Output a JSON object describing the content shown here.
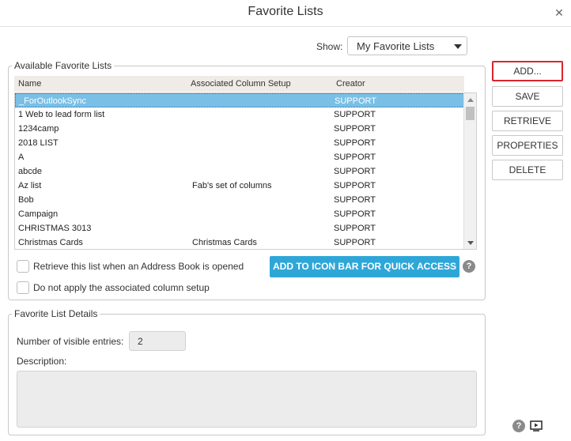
{
  "dialog": {
    "title": "Favorite Lists"
  },
  "show": {
    "label": "Show:",
    "selected": "My Favorite Lists"
  },
  "available": {
    "legend": "Available Favorite Lists",
    "columns": [
      "Name",
      "Associated Column Setup",
      "Creator"
    ],
    "rows": [
      {
        "name": "_ForOutlookSync",
        "setup": "",
        "creator": "SUPPORT",
        "selected": true
      },
      {
        "name": "1 Web to lead form list",
        "setup": "",
        "creator": "SUPPORT"
      },
      {
        "name": "1234camp",
        "setup": "",
        "creator": "SUPPORT"
      },
      {
        "name": "2018 LIST",
        "setup": "",
        "creator": "SUPPORT"
      },
      {
        "name": "A",
        "setup": "",
        "creator": "SUPPORT"
      },
      {
        "name": "abcde",
        "setup": "",
        "creator": "SUPPORT"
      },
      {
        "name": "Az list",
        "setup": "Fab's set of columns",
        "creator": "SUPPORT"
      },
      {
        "name": "Bob",
        "setup": "",
        "creator": "SUPPORT"
      },
      {
        "name": "Campaign",
        "setup": "",
        "creator": "SUPPORT"
      },
      {
        "name": "CHRISTMAS 3013",
        "setup": "",
        "creator": "SUPPORT"
      },
      {
        "name": "Christmas Cards",
        "setup": "Christmas Cards",
        "creator": "SUPPORT"
      }
    ],
    "retrieve_checkbox_label": "Retrieve this list when an Address Book is opened",
    "no_column_checkbox_label": "Do not apply the associated column setup",
    "quick_access_label": "ADD TO ICON BAR FOR QUICK ACCESS"
  },
  "actions": {
    "add": "ADD...",
    "save": "SAVE",
    "retrieve": "RETRIEVE",
    "properties": "PROPERTIES",
    "delete": "DELETE"
  },
  "details": {
    "legend": "Favorite List Details",
    "entries_label": "Number of visible entries:",
    "entries_value": "2",
    "description_label": "Description:",
    "description_value": ""
  },
  "colors": {
    "accent": "#2ea7d8",
    "selection": "#7ac0e6",
    "highlight_border": "#d9262c"
  },
  "icons": [
    "close-icon",
    "chevron-down-icon",
    "help-icon",
    "video-tutorial-icon"
  ]
}
